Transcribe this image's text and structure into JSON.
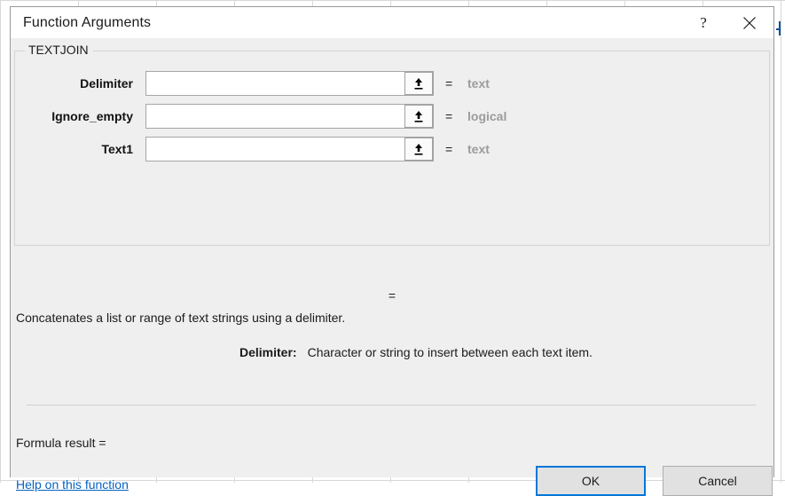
{
  "dialog": {
    "title": "Function Arguments",
    "help_icon": "question-mark-icon",
    "close_icon": "close-icon"
  },
  "function": {
    "name": "TEXTJOIN",
    "description": "Concatenates a list or range of text strings using a delimiter."
  },
  "arguments": [
    {
      "label": "Delimiter",
      "value": "",
      "placeholder": "",
      "equals": "=",
      "type_hint": "text",
      "range_button_icon": "collapse-dialog-arrow-icon"
    },
    {
      "label": "Ignore_empty",
      "value": "",
      "placeholder": "",
      "equals": "=",
      "type_hint": "logical",
      "range_button_icon": "collapse-dialog-arrow-icon"
    },
    {
      "label": "Text1",
      "value": "",
      "placeholder": "",
      "equals": "=",
      "type_hint": "text",
      "range_button_icon": "collapse-dialog-arrow-icon"
    }
  ],
  "result_equals": "=",
  "argument_help": {
    "name": "Delimiter:",
    "text": "Character or string to insert between each text item."
  },
  "formula_result": {
    "label": "Formula result =",
    "value": ""
  },
  "help_link": "Help on this function",
  "buttons": {
    "ok": "OK",
    "cancel": "Cancel"
  },
  "colors": {
    "accent_focus": "#0078d7",
    "link": "#0563c1",
    "dialog_background": "#efefef",
    "titlebar_background": "#ffffff",
    "type_hint": "#9c9c9c"
  }
}
